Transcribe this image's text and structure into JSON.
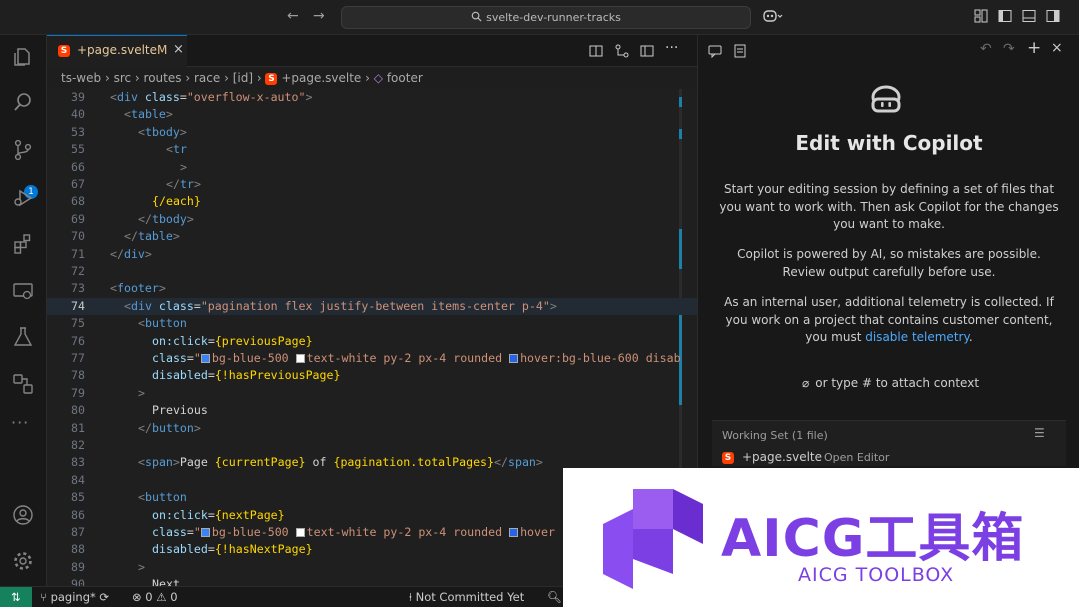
{
  "titlebar": {
    "search_text": "svelte-dev-runner-tracks"
  },
  "activity": {
    "scm_badge": "1"
  },
  "tab": {
    "label": "+page.svelte",
    "modified": "M",
    "close": "×"
  },
  "breadcrumb": [
    "ts-web",
    "src",
    "routes",
    "race",
    "[id]",
    "+page.svelte",
    "footer"
  ],
  "lines": [
    {
      "n": "39",
      "html": "<span class=\"g\">&lt;</span><span class=\"t\">div</span> <span class=\"a\">class</span>=<span class=\"s\">\"overflow-x-auto\"</span><span class=\"g\">&gt;</span>",
      "indent": 0
    },
    {
      "n": "40",
      "html": "<span class=\"g\">&lt;</span><span class=\"t\">table</span><span class=\"g\">&gt;</span>",
      "indent": 2
    },
    {
      "n": "53",
      "html": "<span class=\"g\">&lt;</span><span class=\"t\">tbody</span><span class=\"g\">&gt;</span>",
      "indent": 4
    },
    {
      "n": "55",
      "html": "<span class=\"g\">&lt;</span><span class=\"t\">tr</span>",
      "indent": 8
    },
    {
      "n": "66",
      "html": "<span class=\"g\">&gt;</span>",
      "indent": 10
    },
    {
      "n": "67",
      "html": "<span class=\"g\">&lt;/</span><span class=\"t\">tr</span><span class=\"g\">&gt;</span>",
      "indent": 8
    },
    {
      "n": "68",
      "html": "<span class=\"b\">{/each}</span>",
      "indent": 6
    },
    {
      "n": "69",
      "html": "<span class=\"g\">&lt;/</span><span class=\"t\">tbody</span><span class=\"g\">&gt;</span>",
      "indent": 4
    },
    {
      "n": "70",
      "html": "<span class=\"g\">&lt;/</span><span class=\"t\">table</span><span class=\"g\">&gt;</span>",
      "indent": 2
    },
    {
      "n": "71",
      "html": "<span class=\"g\">&lt;/</span><span class=\"t\">div</span><span class=\"g\">&gt;</span>",
      "indent": 0
    },
    {
      "n": "72",
      "html": "",
      "indent": 0
    },
    {
      "n": "73",
      "html": "<span class=\"g\">&lt;</span><span class=\"t\">footer</span><span class=\"g\">&gt;</span>",
      "indent": 0
    },
    {
      "n": "74",
      "html": "<span class=\"g\">&lt;</span><span class=\"t\">div</span> <span class=\"a\">class</span>=<span class=\"s\">\"pagination flex justify-between items-center p-4\"</span><span class=\"g\">&gt;</span>",
      "indent": 2,
      "active": true
    },
    {
      "n": "75",
      "html": "<span class=\"g\">&lt;</span><span class=\"t\">button</span>",
      "indent": 4
    },
    {
      "n": "76",
      "html": "<span class=\"a\">on:click</span>=<span class=\"b\">{previousPage}</span>",
      "indent": 6
    },
    {
      "n": "77",
      "html": "<span class=\"a\">class</span>=<span class=\"s\">\"<i class=\"sw\" style=\"background:#3b82f6\"></i>bg-blue-500 <i class=\"sw\" style=\"background:#ffffff\"></i>text-white py-2 px-4 rounded <i class=\"sw\" style=\"background:#2563eb\"></i>hover:bg-blue-600 disab</span>",
      "indent": 6
    },
    {
      "n": "78",
      "html": "<span class=\"a\">disabled</span>=<span class=\"b\">{!hasPreviousPage}</span>",
      "indent": 6
    },
    {
      "n": "79",
      "html": "<span class=\"g\">&gt;</span>",
      "indent": 4
    },
    {
      "n": "80",
      "html": "<span class=\"tx\">Previous</span>",
      "indent": 6
    },
    {
      "n": "81",
      "html": "<span class=\"g\">&lt;/</span><span class=\"t\">button</span><span class=\"g\">&gt;</span>",
      "indent": 4
    },
    {
      "n": "82",
      "html": "",
      "indent": 0
    },
    {
      "n": "83",
      "html": "<span class=\"g\">&lt;</span><span class=\"t\">span</span><span class=\"g\">&gt;</span><span class=\"tx\">Page </span><span class=\"b\">{currentPage}</span><span class=\"tx\"> of </span><span class=\"b\">{pagination.totalPages}</span><span class=\"g\">&lt;/</span><span class=\"t\">span</span><span class=\"g\">&gt;</span>",
      "indent": 4
    },
    {
      "n": "84",
      "html": "",
      "indent": 0
    },
    {
      "n": "85",
      "html": "<span class=\"g\">&lt;</span><span class=\"t\">button</span>",
      "indent": 4
    },
    {
      "n": "86",
      "html": "<span class=\"a\">on:click</span>=<span class=\"b\">{nextPage}</span>",
      "indent": 6
    },
    {
      "n": "87",
      "html": "<span class=\"a\">class</span>=<span class=\"s\">\"<i class=\"sw\" style=\"background:#3b82f6\"></i>bg-blue-500 <i class=\"sw\" style=\"background:#ffffff\"></i>text-white py-2 px-4 rounded <i class=\"sw\" style=\"background:#2563eb\"></i>hover</span>",
      "indent": 6
    },
    {
      "n": "88",
      "html": "<span class=\"a\">disabled</span>=<span class=\"b\">{!hasNextPage}</span>",
      "indent": 6
    },
    {
      "n": "89",
      "html": "<span class=\"g\">&gt;</span>",
      "indent": 4
    },
    {
      "n": "90",
      "html": "<span class=\"tx\">Next</span>",
      "indent": 6
    }
  ],
  "copilot": {
    "title": "Edit with Copilot",
    "p1": "Start your editing session by defining a set of files that you want to work with. Then ask Copilot for the changes you want to make.",
    "p2": "Copilot is powered by AI, so mistakes are possible. Review output carefully before use.",
    "p3_pre": "As an internal user, additional telemetry is collected. If you work on a project that contains customer content, you must ",
    "p3_link": "disable telemetry",
    "p3_post": ".",
    "attach": "or type # to attach context",
    "working_set": "Working Set (1 file)",
    "ws_file": "+page.svelte",
    "ws_meta": "Open Editor"
  },
  "status": {
    "branch": "paging*",
    "errors": "0",
    "warnings": "0",
    "commit": "Not Committed Yet"
  },
  "watermark": {
    "big": "AICG工具箱",
    "small": "AICG TOOLBOX"
  }
}
